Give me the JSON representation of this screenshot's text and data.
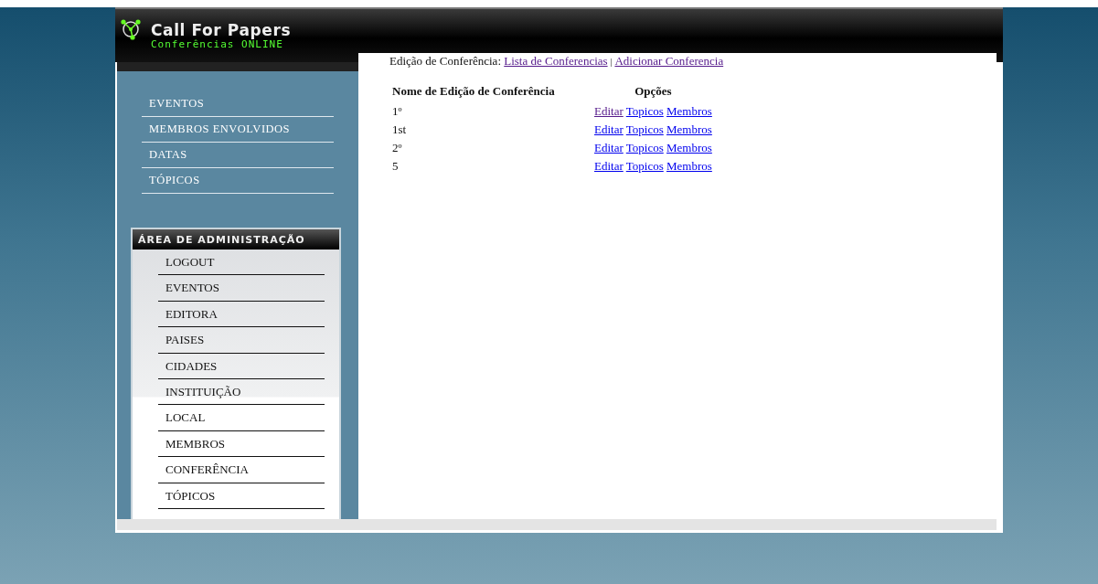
{
  "header": {
    "title": "Call For Papers",
    "subtitle": "Conferências ONLINE"
  },
  "nav": [
    {
      "label": "EVENTOS"
    },
    {
      "label": "MEMBROS ENVOLVIDOS"
    },
    {
      "label": "DATAS"
    },
    {
      "label": "TÓPICOS"
    }
  ],
  "admin": {
    "title": "ÁREA DE ADMINISTRAÇÃO",
    "items": [
      {
        "label": "LOGOUT"
      },
      {
        "label": "EVENTOS"
      },
      {
        "label": "EDITORA"
      },
      {
        "label": "PAISES"
      },
      {
        "label": "CIDADES"
      },
      {
        "label": "INSTITUIÇÃO"
      },
      {
        "label": "LOCAL"
      },
      {
        "label": "MEMBROS"
      },
      {
        "label": "CONFERÊNCIA"
      },
      {
        "label": "TÓPICOS"
      }
    ]
  },
  "breadcrumb": {
    "label": "Edição de Conferência:",
    "separator": "|",
    "links": [
      {
        "text": "Lista de Conferencias",
        "visited": true
      },
      {
        "text": "Adicionar Conferencia",
        "visited": true
      }
    ]
  },
  "table": {
    "columns": [
      "Nome de Edição de Conferência",
      "Opções"
    ],
    "rows": [
      {
        "name": "1º",
        "links": [
          {
            "text": "Editar",
            "visited": true
          },
          {
            "text": "Topicos",
            "visited": false
          },
          {
            "text": "Membros",
            "visited": false
          }
        ]
      },
      {
        "name": "1st",
        "links": [
          {
            "text": "Editar",
            "visited": false
          },
          {
            "text": "Topicos",
            "visited": false
          },
          {
            "text": "Membros",
            "visited": false
          }
        ]
      },
      {
        "name": "2º",
        "links": [
          {
            "text": "Editar",
            "visited": false
          },
          {
            "text": "Topicos",
            "visited": false
          },
          {
            "text": "Membros",
            "visited": false
          }
        ]
      },
      {
        "name": "5",
        "links": [
          {
            "text": "Editar",
            "visited": false
          },
          {
            "text": "Topicos",
            "visited": false
          },
          {
            "text": "Membros",
            "visited": false
          }
        ]
      }
    ]
  }
}
